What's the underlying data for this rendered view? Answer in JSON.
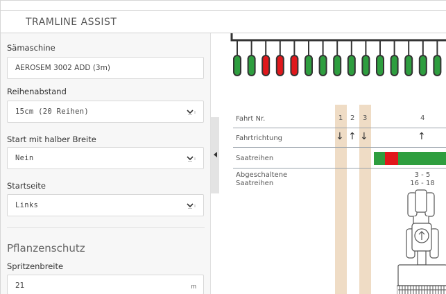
{
  "header": {
    "title": "TRAMLINE ASSIST"
  },
  "form": {
    "machine": {
      "label": "Sämaschine",
      "value": "AEROSEM 3002 ADD (3m)"
    },
    "row_spacing": {
      "label": "Reihenabstand",
      "value": "15cm (20 Reihen)"
    },
    "half_width_start": {
      "label": "Start mit halber Breite",
      "value": "Nein"
    },
    "start_side": {
      "label": "Startseite",
      "value": "Links"
    },
    "crop_protection": {
      "title": "Pflanzenschutz",
      "sprayer_width": {
        "label": "Spritzenbreite",
        "value": "21",
        "unit": "m"
      }
    }
  },
  "visualization": {
    "seed_rows": [
      "green",
      "green",
      "red",
      "red",
      "red",
      "green",
      "green",
      "green",
      "green",
      "green",
      "green",
      "green",
      "green",
      "green",
      "green"
    ],
    "table": {
      "row_labels": {
        "pass_no": "Fahrt Nr.",
        "direction": "Fahrtrichtung",
        "seed_rows": "Saatreihen",
        "disabled_rows": "Abgeschaltene\nSaatreihen"
      },
      "passes": [
        "1",
        "2",
        "3",
        "4"
      ],
      "directions": [
        "↓",
        "↑",
        "↓",
        "↑"
      ],
      "disabled": [
        "3 - 5",
        "16 - 18"
      ]
    },
    "colors": {
      "active": "#2e9e3f",
      "disabled": "#e0181c",
      "highlight": "#efdcc5"
    }
  },
  "icons": {
    "tractor": "tractor-icon",
    "dropdown": "chevron-down-icon",
    "collapse": "chevron-left-icon"
  }
}
